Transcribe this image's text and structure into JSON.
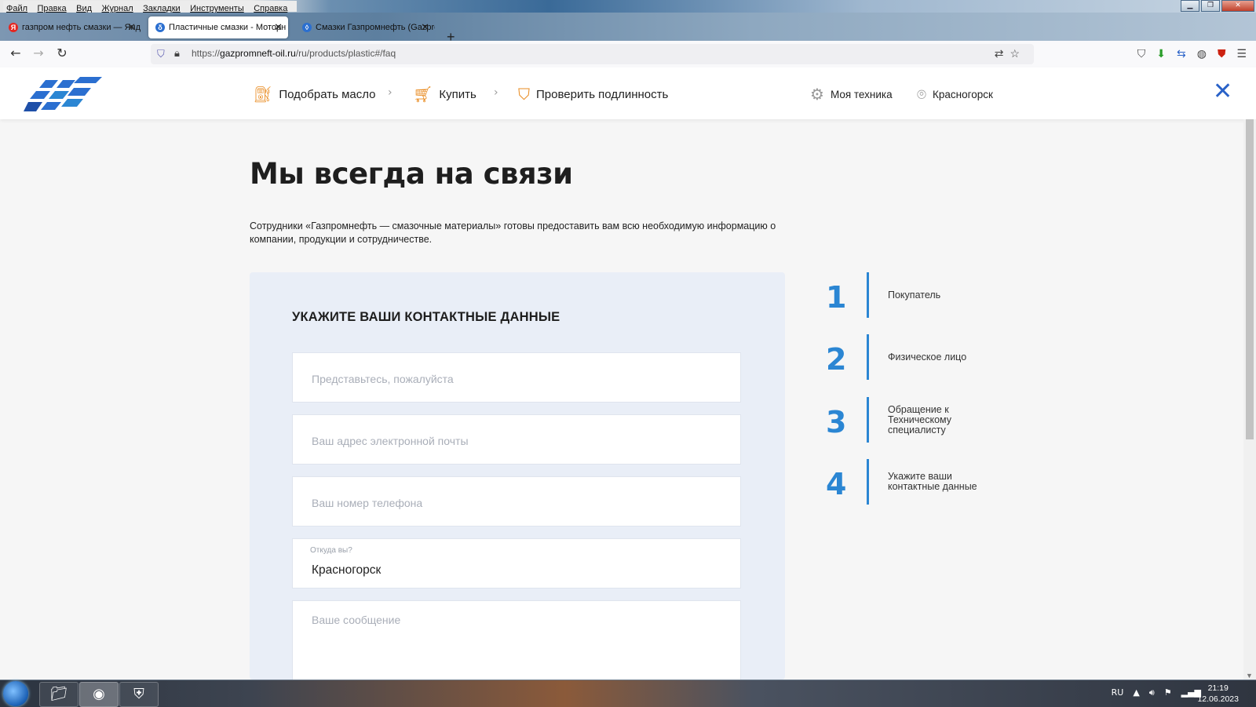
{
  "browser": {
    "menu": [
      "Файл",
      "Правка",
      "Вид",
      "Журнал",
      "Закладки",
      "Инструменты",
      "Справка"
    ],
    "tabs": [
      {
        "label": "газпром нефть смазки — Янд",
        "icon": "yandex-icon"
      },
      {
        "label": "Пластичные смазки - Моторн",
        "icon": "gazprom-flame-icon"
      },
      {
        "label": "Смазки Газпромнефть (Gazpro",
        "icon": "gazprom-drop-icon"
      }
    ],
    "url_prefix": "https://",
    "url_domain": "gazpromneft-oil.ru",
    "url_path": "/ru/products/plastic#/faq"
  },
  "header": {
    "nav": [
      {
        "label": "Подобрать масло",
        "icon": "bottle-icon"
      },
      {
        "label": "Купить",
        "icon": "cart-icon"
      },
      {
        "label": "Проверить подлинность",
        "icon": "shield-check-icon"
      }
    ],
    "my_tech": "Моя техника",
    "city": "Красногорск"
  },
  "page": {
    "title": "Мы всегда на связи",
    "lead": "Сотрудники «Газпромнефть — смазочные материалы» готовы предоставить вам всю необходимую информацию о компании, продукции и сотрудничестве."
  },
  "form": {
    "heading": "УКАЖИТЕ ВАШИ КОНТАКТНЫЕ ДАННЫЕ",
    "name_placeholder": "Представьтесь, пожалуйста",
    "email_placeholder": "Ваш адрес электронной почты",
    "phone_placeholder": "Ваш номер телефона",
    "city_label": "Откуда вы?",
    "city_value": "Красногорск",
    "message_placeholder": "Ваше сообщение"
  },
  "steps": [
    {
      "num": "1",
      "label": "Покупатель"
    },
    {
      "num": "2",
      "label": "Физическое лицо"
    },
    {
      "num": "3",
      "label": "Обращение к Техническому специалисту"
    },
    {
      "num": "4",
      "label": "Укажите ваши контактные данные"
    }
  ],
  "taskbar": {
    "lang": "RU",
    "time": "21:19",
    "date": "12.06.2023"
  },
  "colors": {
    "accent_blue": "#2b86d3",
    "accent_orange": "#e98b20",
    "close_blue": "#2a62c8"
  }
}
